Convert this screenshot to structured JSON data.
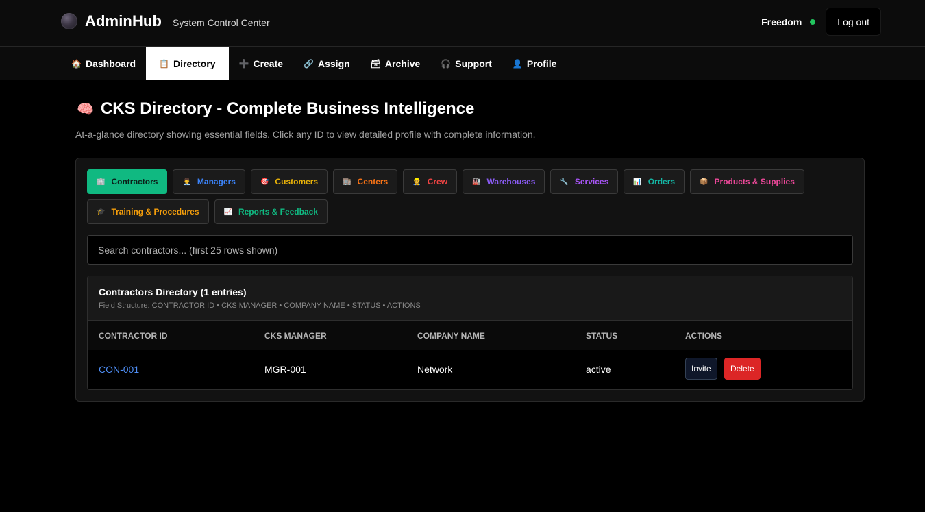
{
  "header": {
    "brand_name": "AdminHub",
    "brand_subtitle": "System Control Center",
    "user_name": "Freedom",
    "logout_label": "Log out",
    "online_color": "#22c55e"
  },
  "nav": {
    "tabs": [
      {
        "label": "Dashboard",
        "icon": "🏠"
      },
      {
        "label": "Directory",
        "icon": "📋"
      },
      {
        "label": "Create",
        "icon": "➕"
      },
      {
        "label": "Assign",
        "icon": "🔗"
      },
      {
        "label": "Archive",
        "icon": "🗃"
      },
      {
        "label": "Support",
        "icon": "🎧"
      },
      {
        "label": "Profile",
        "icon": "👤"
      }
    ],
    "active": "Directory"
  },
  "page": {
    "title_icon": "🧠",
    "title": "CKS Directory - Complete Business Intelligence",
    "description": "At-a-glance directory showing essential fields. Click any ID to view detailed profile with complete information."
  },
  "categories": [
    {
      "label": "Contractors",
      "icon": "🏢",
      "color": "#0b1f19",
      "active": true
    },
    {
      "label": "Managers",
      "icon": "👨‍💼",
      "color": "#3b82f6"
    },
    {
      "label": "Customers",
      "icon": "🎯",
      "color": "#eab308"
    },
    {
      "label": "Centers",
      "icon": "🏬",
      "color": "#f97316"
    },
    {
      "label": "Crew",
      "icon": "👷",
      "color": "#ef4444"
    },
    {
      "label": "Warehouses",
      "icon": "🏭",
      "color": "#8b5cf6"
    },
    {
      "label": "Services",
      "icon": "🔧",
      "color": "#a855f7"
    },
    {
      "label": "Orders",
      "icon": "📊",
      "color": "#14b8a6"
    },
    {
      "label": "Products & Supplies",
      "icon": "📦",
      "color": "#ec4899"
    },
    {
      "label": "Training & Procedures",
      "icon": "🎓",
      "color": "#f59e0b"
    },
    {
      "label": "Reports & Feedback",
      "icon": "📈",
      "color": "#10b981"
    }
  ],
  "search": {
    "placeholder": "Search contractors... (first 25 rows shown)",
    "value": ""
  },
  "table": {
    "title": "Contractors Directory (1 entries)",
    "fields_note": "Field Structure: CONTRACTOR ID • CKS MANAGER • COMPANY NAME • STATUS • ACTIONS",
    "columns": [
      "CONTRACTOR ID",
      "CKS MANAGER",
      "COMPANY NAME",
      "STATUS",
      "ACTIONS"
    ],
    "rows": [
      {
        "id": "CON-001",
        "manager": "MGR-001",
        "company": "Network",
        "status": "active"
      }
    ],
    "invite_label": "Invite",
    "delete_label": "Delete"
  }
}
